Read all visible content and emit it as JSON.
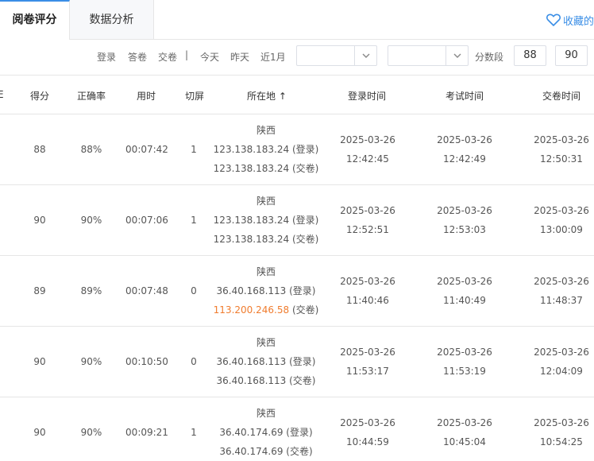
{
  "tabs": {
    "active": "阅卷评分",
    "second": "数据分析",
    "favorite": "收藏的"
  },
  "filters": {
    "links": [
      "登录",
      "答卷",
      "交卷"
    ],
    "separator": "|",
    "time_links": [
      "今天",
      "昨天",
      "近1月"
    ],
    "select1_value": "",
    "select2_value": "",
    "score_range_label": "分数段",
    "score_min": "88",
    "score_max": "90"
  },
  "table": {
    "headers": {
      "left_edge": "E",
      "score": "得分",
      "accuracy": "正确率",
      "duration": "用时",
      "switch": "切屏",
      "location": "所在地",
      "sort_arrow": "↑",
      "login_time": "登录时间",
      "exam_time": "考试时间",
      "submit_time": "交卷时间"
    },
    "rows": [
      {
        "score": "88",
        "accuracy": "88%",
        "duration": "00:07:42",
        "switch": "1",
        "province": "陕西",
        "ip_login": "123.138.183.24",
        "login_suffix": "(登录)",
        "ip_submit": "123.138.183.24",
        "submit_suffix": "(交卷)",
        "login_date": "2025-03-26",
        "login_time": "12:42:45",
        "exam_date": "2025-03-26",
        "exam_time": "12:42:49",
        "submit_date": "2025-03-26",
        "submit_time": "12:50:31"
      },
      {
        "score": "90",
        "accuracy": "90%",
        "duration": "00:07:06",
        "switch": "1",
        "province": "陕西",
        "ip_login": "123.138.183.24",
        "login_suffix": "(登录)",
        "ip_submit": "123.138.183.24",
        "submit_suffix": "(交卷)",
        "login_date": "2025-03-26",
        "login_time": "12:52:51",
        "exam_date": "2025-03-26",
        "exam_time": "12:53:03",
        "submit_date": "2025-03-26",
        "submit_time": "13:00:09"
      },
      {
        "score": "89",
        "accuracy": "89%",
        "duration": "00:07:48",
        "switch": "0",
        "province": "陕西",
        "ip_login": "36.40.168.113",
        "login_suffix": "(登录)",
        "ip_submit": "113.200.246.58",
        "submit_suffix": "(交卷)",
        "login_date": "2025-03-26",
        "login_time": "11:40:46",
        "exam_date": "2025-03-26",
        "exam_time": "11:40:49",
        "submit_date": "2025-03-26",
        "submit_time": "11:48:37"
      },
      {
        "score": "90",
        "accuracy": "90%",
        "duration": "00:10:50",
        "switch": "0",
        "province": "陕西",
        "ip_login": "36.40.168.113",
        "login_suffix": "(登录)",
        "ip_submit": "36.40.168.113",
        "submit_suffix": "(交卷)",
        "login_date": "2025-03-26",
        "login_time": "11:53:17",
        "exam_date": "2025-03-26",
        "exam_time": "11:53:19",
        "submit_date": "2025-03-26",
        "submit_time": "12:04:09"
      },
      {
        "score": "90",
        "accuracy": "90%",
        "duration": "00:09:21",
        "switch": "1",
        "province": "陕西",
        "ip_login": "36.40.174.69",
        "login_suffix": "(登录)",
        "ip_submit": "36.40.174.69",
        "submit_suffix": "(交卷)",
        "login_date": "2025-03-26",
        "login_time": "10:44:59",
        "exam_date": "2025-03-26",
        "exam_time": "10:45:04",
        "submit_date": "2025-03-26",
        "submit_time": "10:54:25"
      }
    ]
  },
  "colors": {
    "accent": "#3a8ee6",
    "warning_ip": "#f07c2e",
    "border": "#e6e6e6"
  },
  "icons": {
    "favorite": "heart-outline-icon",
    "dropdown": "chevron-down-icon"
  }
}
